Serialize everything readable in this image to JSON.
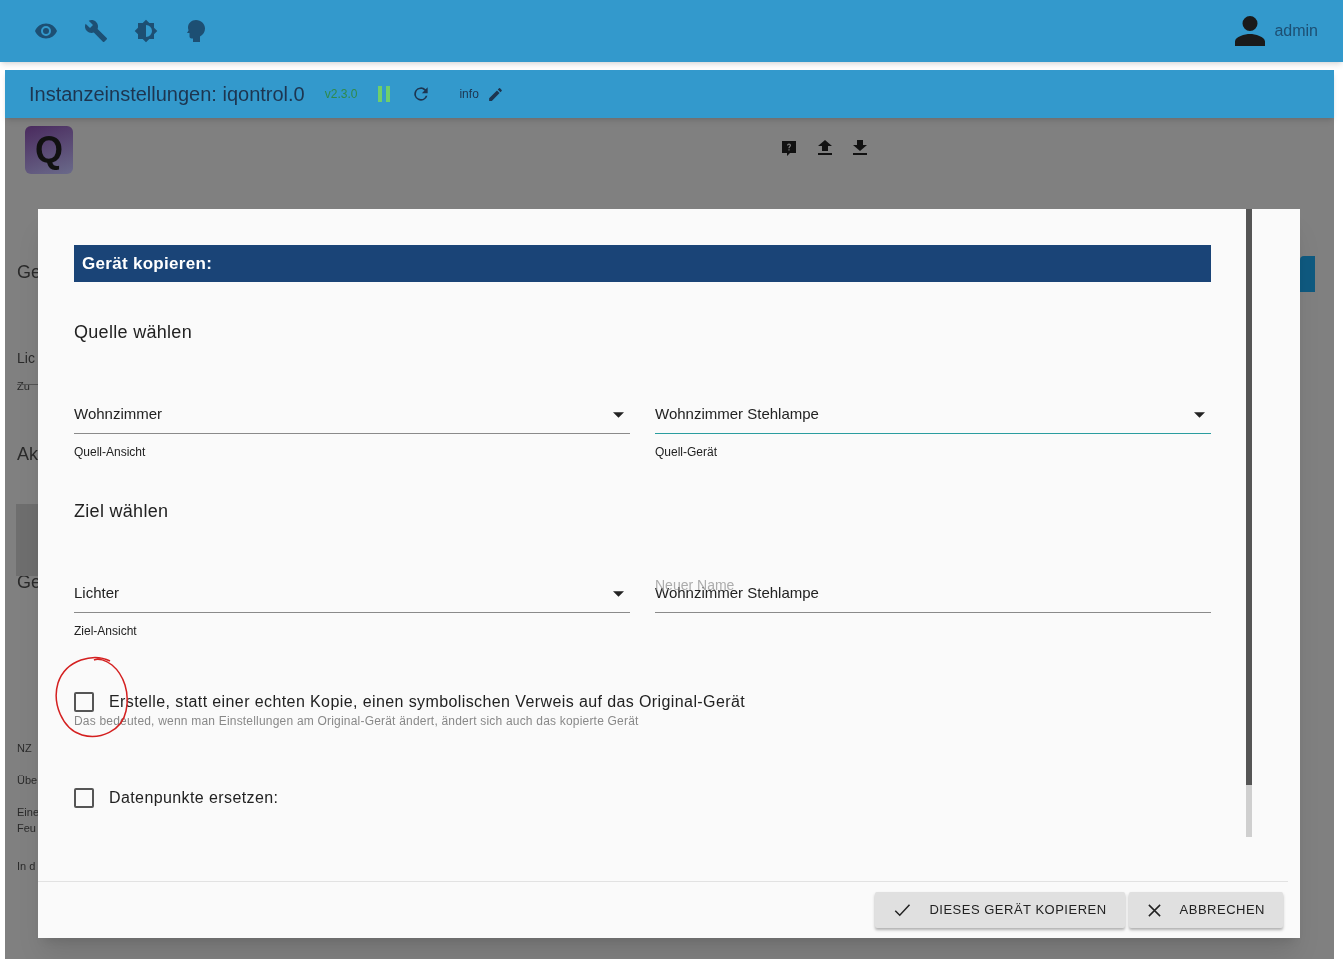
{
  "top_bar": {
    "user": "admin"
  },
  "instance_bar": {
    "title": "Instanzeinstellungen: iqontrol.0",
    "version": "v2.3.0",
    "info": "info"
  },
  "logo": {
    "letter": "Q"
  },
  "background_fragments": [
    {
      "text": "Ge",
      "kind": "heading"
    },
    {
      "text": "Lic",
      "kind": "field"
    },
    {
      "text": "Zu",
      "kind": "small"
    },
    {
      "text": "Ak",
      "kind": "heading"
    },
    {
      "text": "Ge",
      "kind": "heading"
    },
    {
      "text": "NZ",
      "kind": "small"
    },
    {
      "text": "Übe",
      "kind": "small"
    },
    {
      "text": "Eine",
      "kind": "small"
    },
    {
      "text": "Feu",
      "kind": "small"
    },
    {
      "text": "In d",
      "kind": "small"
    }
  ],
  "dialog": {
    "title": "Gerät kopieren:",
    "sections": [
      {
        "heading": "Quelle wählen",
        "fields": [
          {
            "kind": "select",
            "value": "Wohnzimmer",
            "helper": "Quell-Ansicht",
            "focused": false
          },
          {
            "kind": "select",
            "value": "Wohnzimmer Stehlampe",
            "helper": "Quell-Gerät",
            "focused": true
          }
        ]
      },
      {
        "heading": "Ziel wählen",
        "fields": [
          {
            "kind": "select",
            "value": "Lichter",
            "helper": "Ziel-Ansicht",
            "focused": false
          },
          {
            "kind": "text",
            "label": "Neuer Name",
            "value": "Wohnzimmer Stehlampe",
            "focused": false
          }
        ]
      }
    ],
    "checkboxes": [
      {
        "label": "Erstelle, statt einer echten Kopie, einen symbolischen Verweis auf das Original-Gerät",
        "hint": "Das bedeuted, wenn man Einstellungen am Original-Gerät ändert, ändert sich auch das kopierte Gerät",
        "checked": false,
        "annotated": true
      },
      {
        "label": "Datenpunkte ersetzen:",
        "checked": false,
        "annotated": false
      }
    ],
    "buttons": [
      {
        "kind": "confirm",
        "label": "DIESES GERÄT KOPIEREN"
      },
      {
        "kind": "cancel",
        "label": "ABBRECHEN"
      }
    ]
  }
}
